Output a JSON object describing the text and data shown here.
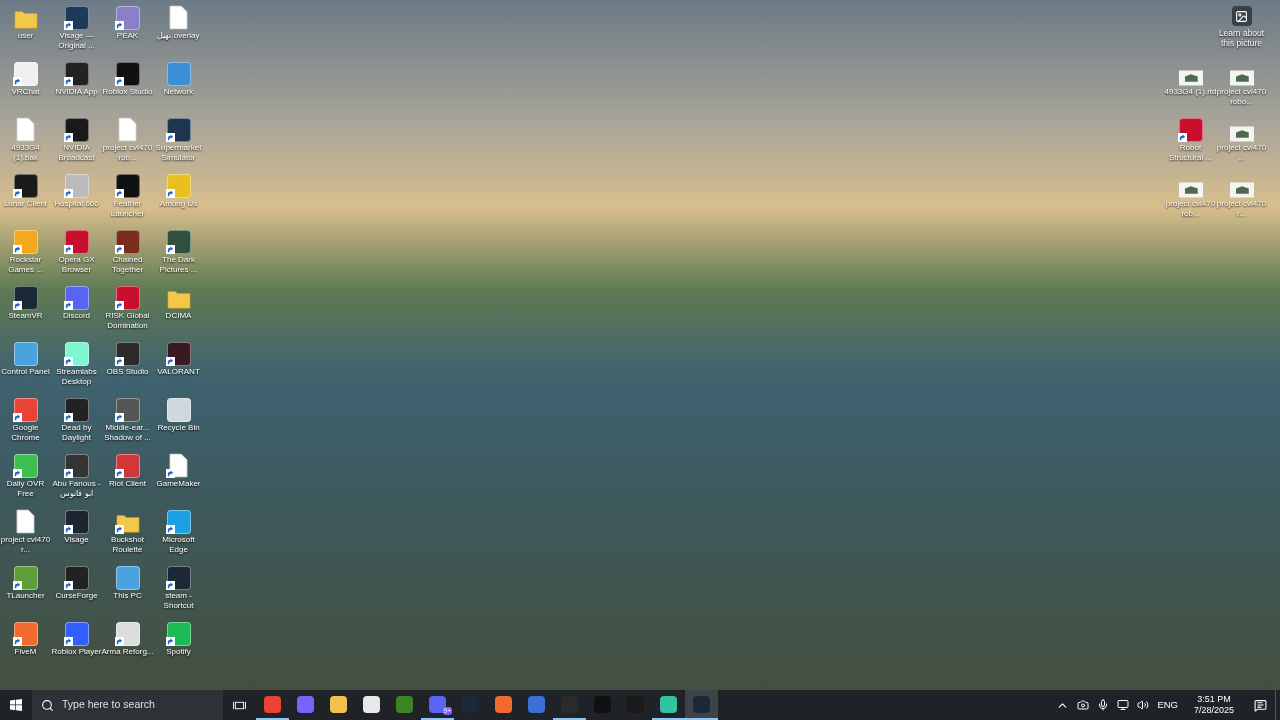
{
  "left_icons": [
    {
      "label": "user",
      "kind": "folder",
      "shortcut": false
    },
    {
      "label": "Visage — Original ...",
      "kind": "app",
      "color": "#1d3a5c",
      "shortcut": true
    },
    {
      "label": "PEAK",
      "kind": "app",
      "color": "#8a7fc8",
      "shortcut": true
    },
    {
      "label": "نهيل.overlay",
      "kind": "file",
      "shortcut": false
    },
    {
      "label": "VRChat",
      "kind": "app",
      "color": "#f0f0f0",
      "shortcut": true
    },
    {
      "label": "NVIDIA App",
      "kind": "app",
      "color": "#222222",
      "shortcut": true
    },
    {
      "label": "Roblox Studio",
      "kind": "app",
      "color": "#111111",
      "shortcut": true
    },
    {
      "label": "Network",
      "kind": "app",
      "color": "#3a8fd6",
      "shortcut": false
    },
    {
      "label": "4933G4 (1).bak",
      "kind": "file",
      "shortcut": false
    },
    {
      "label": "NVIDIA Broadcast",
      "kind": "app",
      "color": "#1a1a1a",
      "shortcut": true
    },
    {
      "label": "project cvl470 rob...",
      "kind": "file",
      "shortcut": false
    },
    {
      "label": "Supermarket Simulator",
      "kind": "app",
      "color": "#1e3550",
      "shortcut": true
    },
    {
      "label": "Lunar Client",
      "kind": "app",
      "color": "#1a1a1a",
      "shortcut": true
    },
    {
      "label": "Hospital 666",
      "kind": "app",
      "color": "#bbbbbb",
      "shortcut": true
    },
    {
      "label": "Feather Launcher",
      "kind": "app",
      "color": "#111111",
      "shortcut": true
    },
    {
      "label": "Among Us",
      "kind": "app",
      "color": "#e8c020",
      "shortcut": true
    },
    {
      "label": "Rockstar Games ...",
      "kind": "app",
      "color": "#f4a81d",
      "shortcut": true
    },
    {
      "label": "Opera GX Browser",
      "kind": "app",
      "color": "#c8102e",
      "shortcut": true
    },
    {
      "label": "Chained Together",
      "kind": "app",
      "color": "#7a2d1a",
      "shortcut": true
    },
    {
      "label": "The Dark Pictures ...",
      "kind": "app",
      "color": "#2f4f3f",
      "shortcut": true
    },
    {
      "label": "SteamVR",
      "kind": "app",
      "color": "#1b2838",
      "shortcut": true
    },
    {
      "label": "Discord",
      "kind": "app",
      "color": "#5865f2",
      "shortcut": true
    },
    {
      "label": "RISK Global Domination",
      "kind": "app",
      "color": "#c8102e",
      "shortcut": true
    },
    {
      "label": "DCIMA",
      "kind": "folder",
      "shortcut": false
    },
    {
      "label": "Control Panel",
      "kind": "app",
      "color": "#4aa3df",
      "shortcut": false
    },
    {
      "label": "Streamlabs Desktop",
      "kind": "app",
      "color": "#80f5d2",
      "shortcut": true
    },
    {
      "label": "OBS Studio",
      "kind": "app",
      "color": "#2b2b2b",
      "shortcut": true
    },
    {
      "label": "VALORANT",
      "kind": "app",
      "color": "#3a1a22",
      "shortcut": true
    },
    {
      "label": "Google Chrome",
      "kind": "app",
      "color": "#ea4335",
      "shortcut": true
    },
    {
      "label": "Dead by Daylight",
      "kind": "app",
      "color": "#222222",
      "shortcut": true
    },
    {
      "label": "Middle-ear... Shadow of ...",
      "kind": "app",
      "color": "#555555",
      "shortcut": true
    },
    {
      "label": "Recycle Bin",
      "kind": "app",
      "color": "#cfd8dc",
      "shortcut": false
    },
    {
      "label": "Daily OVR Free",
      "kind": "app",
      "color": "#3fbf4f",
      "shortcut": true
    },
    {
      "label": "Abu Fanous - ابو فانوس",
      "kind": "app",
      "color": "#333333",
      "shortcut": true
    },
    {
      "label": "Riot Client",
      "kind": "app",
      "color": "#d13639",
      "shortcut": true
    },
    {
      "label": "GameMaker",
      "kind": "file",
      "shortcut": true
    },
    {
      "label": "project cvl470 r...",
      "kind": "file",
      "shortcut": false
    },
    {
      "label": "Visage",
      "kind": "app",
      "color": "#1d2630",
      "shortcut": true
    },
    {
      "label": "Buckshot Roulette",
      "kind": "folder",
      "shortcut": true
    },
    {
      "label": "Microsoft Edge",
      "kind": "app",
      "color": "#1ba1e2",
      "shortcut": true
    },
    {
      "label": "TLauncher",
      "kind": "app",
      "color": "#5d9e3a",
      "shortcut": true
    },
    {
      "label": "CurseForge",
      "kind": "app",
      "color": "#222222",
      "shortcut": true
    },
    {
      "label": "This PC",
      "kind": "app",
      "color": "#4aa3df",
      "shortcut": false
    },
    {
      "label": "steam - Shortcut",
      "kind": "app",
      "color": "#1b2838",
      "shortcut": true
    },
    {
      "label": "FiveM",
      "kind": "app",
      "color": "#f26a2d",
      "shortcut": true
    },
    {
      "label": "Roblox Player",
      "kind": "app",
      "color": "#335fff",
      "shortcut": true
    },
    {
      "label": "Arma Reforg...",
      "kind": "app",
      "color": "#dddddd",
      "shortcut": true
    },
    {
      "label": "Spotify",
      "kind": "app",
      "color": "#1db954",
      "shortcut": true
    }
  ],
  "learn_about_picture": {
    "label": "Learn about this picture"
  },
  "right_icons": [
    {
      "label": "4933G4 (1).rtd",
      "kind": "thumbnail",
      "shortcut": false
    },
    {
      "label": "project cvl470 robo...",
      "kind": "thumbnail",
      "shortcut": false
    },
    {
      "label": "Robot Structural ...",
      "kind": "app",
      "color": "#c8102e",
      "shortcut": true
    },
    {
      "label": "project cvl470 ...",
      "kind": "thumbnail",
      "shortcut": false
    },
    {
      "label": "project cvl470 rob...",
      "kind": "thumbnail",
      "shortcut": false
    },
    {
      "label": "project cvl470 r...",
      "kind": "thumbnail",
      "shortcut": false
    }
  ],
  "taskbar": {
    "search": {
      "placeholder": "Type here to search"
    },
    "apps": [
      {
        "color": "#ea4335",
        "running": true,
        "selected": false
      },
      {
        "color": "#7b61ff",
        "running": false,
        "selected": false
      },
      {
        "color": "#f2c14e",
        "running": false,
        "selected": false
      },
      {
        "color": "#e8e8e8",
        "running": false,
        "selected": false
      },
      {
        "color": "#3c8527",
        "running": false,
        "selected": false
      },
      {
        "color": "#5865f2",
        "running": true,
        "selected": false,
        "badge": "9+"
      },
      {
        "color": "#1b2838",
        "running": false,
        "selected": false
      },
      {
        "color": "#f26a2d",
        "running": false,
        "selected": false
      },
      {
        "color": "#3a6fd6",
        "running": false,
        "selected": false
      },
      {
        "color": "#2b2b2b",
        "running": true,
        "selected": false
      },
      {
        "color": "#111111",
        "running": false,
        "selected": false
      },
      {
        "color": "#1a1a1a",
        "running": false,
        "selected": false
      },
      {
        "color": "#31c3a2",
        "running": true,
        "selected": false
      },
      {
        "color": "#1b2838",
        "running": true,
        "selected": true
      }
    ],
    "language": "ENG",
    "time": "3:51 PM",
    "date": "7/28/2025"
  }
}
